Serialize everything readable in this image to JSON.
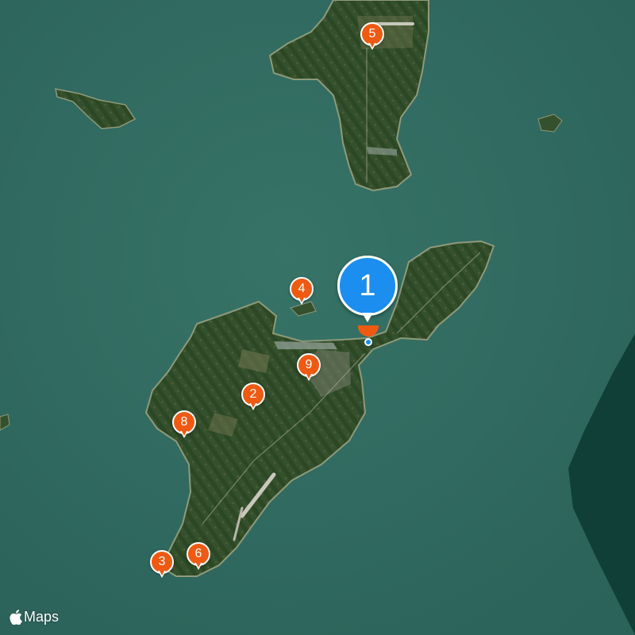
{
  "map": {
    "kind": "satellite",
    "colors": {
      "water": "#2f6a62",
      "deep_water": "#0f3f37",
      "land": "#34502c",
      "land_dark": "#28421f",
      "field": "#6f7650",
      "shore": "#8f9a7a"
    }
  },
  "markers": [
    {
      "label": "1",
      "icon": "map-pin",
      "color": "#1b8ef0",
      "selected": true
    },
    {
      "label": "2",
      "icon": "map-pin",
      "color": "#ef5a12",
      "selected": false
    },
    {
      "label": "3",
      "icon": "map-pin",
      "color": "#ef5a12",
      "selected": false
    },
    {
      "label": "4",
      "icon": "map-pin",
      "color": "#ef5a12",
      "selected": false
    },
    {
      "label": "5",
      "icon": "map-pin",
      "color": "#ef5a12",
      "selected": false
    },
    {
      "label": "6",
      "icon": "map-pin",
      "color": "#ef5a12",
      "selected": false
    },
    {
      "label": "8",
      "icon": "map-pin",
      "color": "#ef5a12",
      "selected": false
    },
    {
      "label": "9",
      "icon": "map-pin",
      "color": "#ef5a12",
      "selected": false
    }
  ],
  "current_location": {
    "icon": "current-location-dot",
    "color": "#1b8ef0"
  },
  "attribution": {
    "icon": "apple-logo-icon",
    "text": "Maps"
  }
}
